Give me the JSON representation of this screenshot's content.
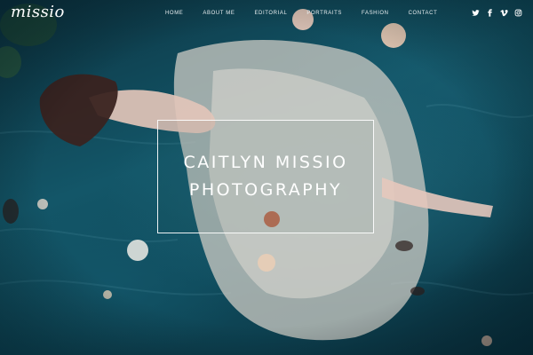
{
  "site": {
    "logo_text": "missio"
  },
  "nav": {
    "items": [
      {
        "label": "HOME"
      },
      {
        "label": "ABOUT ME"
      },
      {
        "label": "EDITORIAL"
      },
      {
        "label": "PORTRAITS"
      },
      {
        "label": "FASHION"
      },
      {
        "label": "CONTACT"
      }
    ]
  },
  "social": {
    "icons": [
      "twitter-icon",
      "facebook-icon",
      "vimeo-icon",
      "instagram-icon"
    ]
  },
  "hero": {
    "title_line1": "CAITLYN MISSIO",
    "title_line2": "PHOTOGRAPHY"
  },
  "colors": {
    "background": "#135668",
    "text": "#ffffff"
  }
}
